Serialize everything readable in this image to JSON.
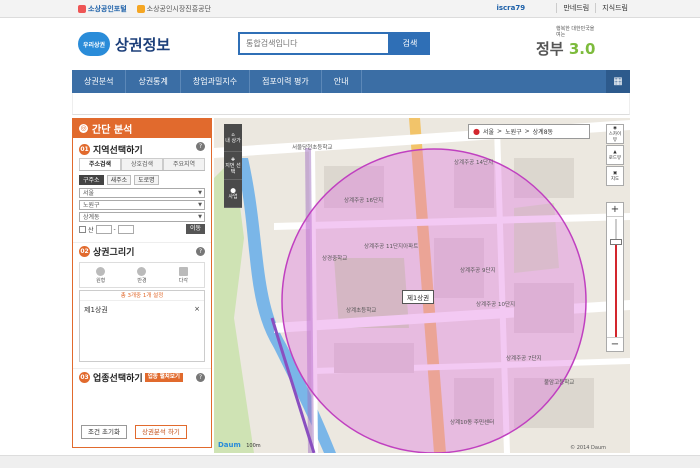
{
  "topbar": {
    "logo1": "소상공인포털",
    "logo2": "소상공인시장진흥공단",
    "user": "iscra79",
    "links": [
      "만네드림",
      "지식드림"
    ]
  },
  "header": {
    "brand_badge": "우리상권",
    "title": "상권정보",
    "search_placeholder": "통합검색입니다",
    "search_button": "검색",
    "gov_small": "행복한 대한민국을 여는",
    "gov_big": "정부",
    "gov_version": "3.0"
  },
  "nav": [
    "상권분석",
    "상권통계",
    "창업과밀지수",
    "점포이력 평가",
    "안내"
  ],
  "panel": {
    "title": "간단 분석",
    "section1": {
      "num": "01",
      "title": "지역선택하기",
      "tabs": [
        "주소검색",
        "상호검색",
        "주요지역"
      ],
      "radios": [
        "구주소",
        "새주소",
        "도로명"
      ],
      "selects": [
        "서울",
        "노원구",
        "상계동"
      ],
      "zip_label": "산",
      "zip_sep": "-",
      "go": "이동"
    },
    "section2": {
      "num": "02",
      "title": "상권그리기",
      "tools": [
        "원형",
        "반경",
        "다각"
      ],
      "caption": "총 3개중 1개 설정",
      "areas": [
        {
          "name": "제1상권",
          "remove": "×"
        }
      ]
    },
    "section3": {
      "num": "03",
      "title": "업종선택하기",
      "btn": "업종 펼쳐보기"
    },
    "buttons": {
      "reset": "조건 초기화",
      "analyze": "상권분석 하기"
    }
  },
  "map": {
    "location": [
      "서울",
      ">",
      "노원구",
      ">",
      "상계8동"
    ],
    "left_tools": [
      "내 상가",
      "지번 선택",
      "사업"
    ],
    "right_tools": [
      "스카이뷰",
      "로드뷰",
      "지도"
    ],
    "area_label": "제1상권",
    "scale": "100m",
    "brand": "Daum",
    "copyright": "© 2014 Daum",
    "colors": {
      "circle": "#e070e0",
      "road": "#f2c46a"
    },
    "labels": [
      {
        "text": "서울당현초등학교"
      },
      {
        "text": "상계주공 14단지"
      },
      {
        "text": "상계주공 16단지"
      },
      {
        "text": "상계주공 11단지아파트"
      },
      {
        "text": "상계주공 9단지"
      },
      {
        "text": "상계주공 10단지"
      },
      {
        "text": "상경중학교"
      },
      {
        "text": "상계초등학교"
      },
      {
        "text": "상계주공 7단지"
      },
      {
        "text": "불암고등학교"
      },
      {
        "text": "상계10동 주민센터"
      }
    ]
  }
}
